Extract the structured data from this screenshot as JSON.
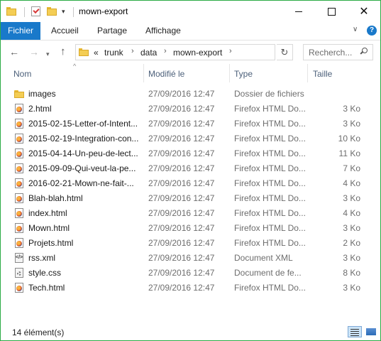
{
  "window": {
    "title": "mown-export"
  },
  "quick_access": {
    "items": [
      "folder-icon",
      "properties-icon",
      "new-folder-icon"
    ],
    "dropdown_glyph": "▾"
  },
  "ribbon": {
    "file_tab": "Fichier",
    "tabs": [
      "Accueil",
      "Partage",
      "Affichage"
    ],
    "expand_glyph": "∨",
    "help_glyph": "?"
  },
  "address": {
    "overflow": "«",
    "crumbs": [
      "trunk",
      "data",
      "mown-export"
    ],
    "separator": "›",
    "search_placeholder": "Recherch..."
  },
  "columns": {
    "name": "Nom",
    "modified": "Modifié le",
    "type": "Type",
    "size": "Taille"
  },
  "files": [
    {
      "name": "images",
      "modified": "27/09/2016 12:47",
      "type": "Dossier de fichiers",
      "size": "",
      "icon": "folder"
    },
    {
      "name": "2.html",
      "modified": "27/09/2016 12:47",
      "type": "Firefox HTML Do...",
      "size": "3 Ko",
      "icon": "firefox-html"
    },
    {
      "name": "2015-02-15-Letter-of-Intent...",
      "modified": "27/09/2016 12:47",
      "type": "Firefox HTML Do...",
      "size": "3 Ko",
      "icon": "firefox-html"
    },
    {
      "name": "2015-02-19-Integration-con...",
      "modified": "27/09/2016 12:47",
      "type": "Firefox HTML Do...",
      "size": "10 Ko",
      "icon": "firefox-html"
    },
    {
      "name": "2015-04-14-Un-peu-de-lect...",
      "modified": "27/09/2016 12:47",
      "type": "Firefox HTML Do...",
      "size": "11 Ko",
      "icon": "firefox-html"
    },
    {
      "name": "2015-09-09-Qui-veut-la-pe...",
      "modified": "27/09/2016 12:47",
      "type": "Firefox HTML Do...",
      "size": "7 Ko",
      "icon": "firefox-html"
    },
    {
      "name": "2016-02-21-Mown-ne-fait-...",
      "modified": "27/09/2016 12:47",
      "type": "Firefox HTML Do...",
      "size": "4 Ko",
      "icon": "firefox-html"
    },
    {
      "name": "Blah-blah.html",
      "modified": "27/09/2016 12:47",
      "type": "Firefox HTML Do...",
      "size": "3 Ko",
      "icon": "firefox-html"
    },
    {
      "name": "index.html",
      "modified": "27/09/2016 12:47",
      "type": "Firefox HTML Do...",
      "size": "4 Ko",
      "icon": "firefox-html"
    },
    {
      "name": "Mown.html",
      "modified": "27/09/2016 12:47",
      "type": "Firefox HTML Do...",
      "size": "3 Ko",
      "icon": "firefox-html"
    },
    {
      "name": "Projets.html",
      "modified": "27/09/2016 12:47",
      "type": "Firefox HTML Do...",
      "size": "2 Ko",
      "icon": "firefox-html"
    },
    {
      "name": "rss.xml",
      "modified": "27/09/2016 12:47",
      "type": "Document XML",
      "size": "3 Ko",
      "icon": "xml"
    },
    {
      "name": "style.css",
      "modified": "27/09/2016 12:47",
      "type": "Document de fe...",
      "size": "8 Ko",
      "icon": "css"
    },
    {
      "name": "Tech.html",
      "modified": "27/09/2016 12:47",
      "type": "Firefox HTML Do...",
      "size": "3 Ko",
      "icon": "firefox-html"
    }
  ],
  "status": {
    "count": "14 élément(s)"
  },
  "colors": {
    "accent": "#1979ca",
    "window_border": "#2bab45",
    "folder": "#f4cd54"
  }
}
